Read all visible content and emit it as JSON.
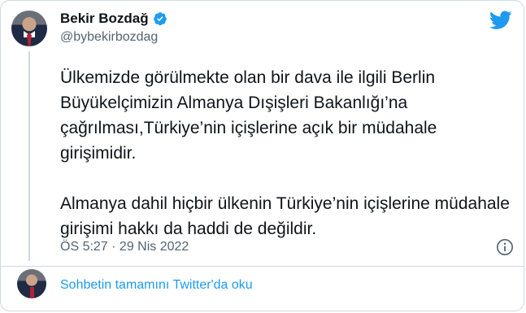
{
  "author": {
    "display_name": "Bekir Bozdağ",
    "handle": "@bybekirbozdag",
    "verified": true
  },
  "tweet": {
    "paragraph_1": "Ülkemizde görülmekte olan bir dava ile ilgili Berlin Büyükelçimizin Almanya Dışişleri Bakanlığı’na çağrılması,Türkiye’nin içişlerine açık bir müdahale girişimidir.",
    "paragraph_2": "Almanya dahil hiçbir ülkenin Türkiye’nin içişlerine müdahale girişimi hakkı da haddi de değildir.",
    "timestamp": "ÖS 5:27 · 29 Nis 2022"
  },
  "footer": {
    "read_more_label": "Sohbetin tamamını Twitter'da oku"
  },
  "icons": {
    "brand": "twitter-bird-icon",
    "verified": "verified-badge-icon",
    "info": "info-icon"
  },
  "colors": {
    "accent": "#1d9bf0",
    "text": "#0f1419",
    "muted": "#536471",
    "border": "#cfd9de"
  }
}
